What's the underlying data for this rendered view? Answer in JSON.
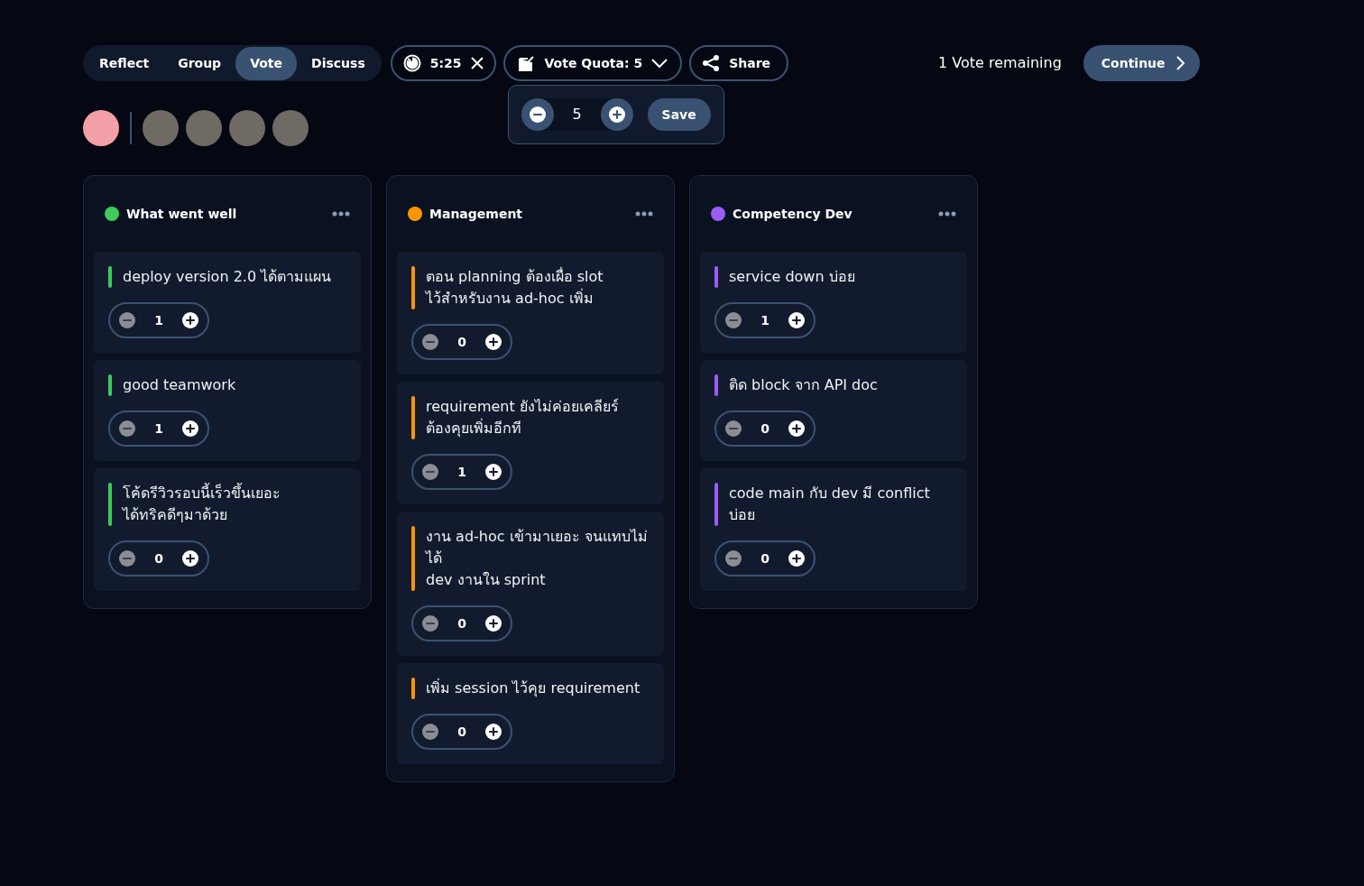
{
  "stages": [
    {
      "label": "Reflect",
      "selected": false
    },
    {
      "label": "Group",
      "selected": false
    },
    {
      "label": "Vote",
      "selected": true
    },
    {
      "label": "Discuss",
      "selected": false
    }
  ],
  "timer": {
    "time": "5:25"
  },
  "vote_quota": {
    "label": "Vote Quota: 5",
    "expanded": true,
    "popover": {
      "value": "5",
      "save": "Save"
    }
  },
  "share": "Share",
  "votes_remaining": "1 Vote remaining",
  "continue": "Continue",
  "avatars": [
    {
      "kind": "self"
    },
    {
      "kind": "member"
    },
    {
      "kind": "member"
    },
    {
      "kind": "member"
    },
    {
      "kind": "member"
    }
  ],
  "columns": [
    {
      "title": "What went well",
      "color": "#3ec95c",
      "cards": [
        {
          "text": "deploy version 2.0 ได้ตามแผน",
          "votes": "1"
        },
        {
          "text": "good teamwork",
          "votes": "1"
        },
        {
          "text": "โค้ดรีวิวรอบนี้เร็วขึ้นเยอะ\nได้ทริคดีๆมาด้วย",
          "votes": "0"
        }
      ]
    },
    {
      "title": "Management",
      "color": "#ff9500",
      "cards": [
        {
          "text": "ตอน planning ต้องเผื่อ slot\nไว้สำหรับงาน ad-hoc เพิ่ม",
          "votes": "0"
        },
        {
          "text": "requirement ยังไม่ค่อยเคลียร์\nต้องคุยเพิ่มอีกที",
          "votes": "1"
        },
        {
          "text": "งาน ad-hoc เข้ามาเยอะ จนแทบไม่ได้\ndev งานใน sprint",
          "votes": "0"
        },
        {
          "text": "เพิ่ม session ไว้คุย requirement",
          "votes": "0"
        }
      ]
    },
    {
      "title": "Competency Dev",
      "color": "#9b5cf6",
      "cards": [
        {
          "text": "service down บ่อย",
          "votes": "1"
        },
        {
          "text": "ติด block จาก API doc",
          "votes": "0"
        },
        {
          "text": "code main กับ dev มี conflict\nบ่อย",
          "votes": "0"
        }
      ]
    }
  ]
}
